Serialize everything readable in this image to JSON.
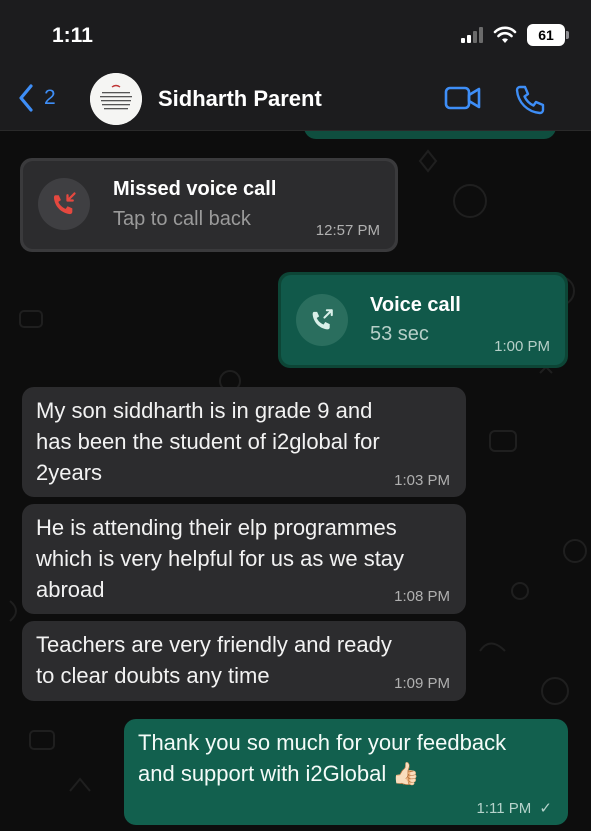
{
  "status_bar": {
    "time": "1:11",
    "battery": "61"
  },
  "header": {
    "back_count": "2",
    "contact_name": "Sidharth Parent",
    "avatar_text": "Beauty isn't about having a pretty face. It's about having a pretty mind, a pretty heart and most importantly a beautiful soul"
  },
  "messages": [
    {
      "type": "missed-call",
      "title": "Missed voice call",
      "subtitle": "Tap to call back",
      "time": "12:57 PM"
    },
    {
      "type": "voice-call",
      "title": "Voice call",
      "subtitle": "53 sec",
      "time": "1:00 PM"
    },
    {
      "type": "incoming",
      "lines": [
        "My son siddharth is in grade 9 and",
        "has been the student of i2global for",
        "2years"
      ],
      "time": "1:03 PM"
    },
    {
      "type": "incoming",
      "lines": [
        "He is attending their elp programmes",
        "which is very helpful for us as we stay",
        "abroad"
      ],
      "time": "1:08 PM"
    },
    {
      "type": "incoming",
      "lines": [
        "Teachers are very friendly and ready",
        "to clear doubts  any time"
      ],
      "time": "1:09 PM"
    },
    {
      "type": "outgoing",
      "lines": [
        "Thank you so much for your feedback",
        "and support with i2Global 👍🏻"
      ],
      "time": "1:11 PM",
      "status": "✓"
    }
  ],
  "colors": {
    "accent": "#3e8ef7",
    "incoming_bubble": "#2c2c2e",
    "outgoing_bubble": "#0f4e3f",
    "missed": "#e5483f"
  },
  "icons": [
    "back-chevron-icon",
    "video-call-icon",
    "phone-icon",
    "missed-call-icon",
    "outgoing-call-icon",
    "signal-icon",
    "wifi-icon",
    "battery-icon",
    "read-check-icon"
  ]
}
